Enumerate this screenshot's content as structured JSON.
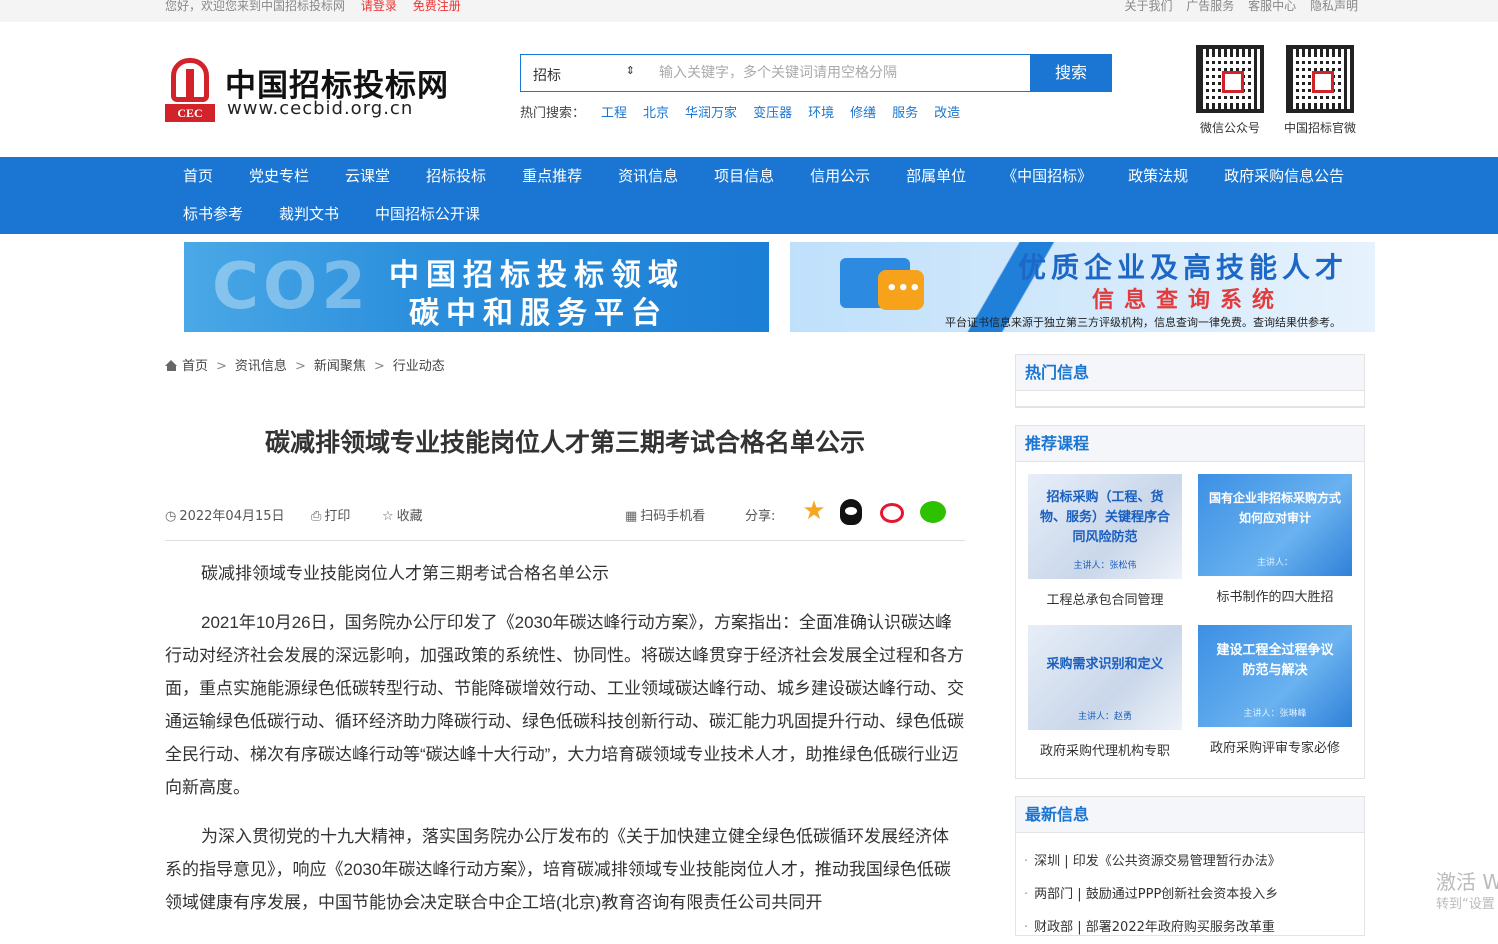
{
  "topbar": {
    "greeting": "您好，欢迎您来到中国招标投标网",
    "login": "请登录",
    "register": "免费注册",
    "links": [
      "关于我们",
      "广告服务",
      "客服中心",
      "隐私声明"
    ]
  },
  "header": {
    "logo_name": "中国招标投标网",
    "logo_url": "www.cecbid.org.cn",
    "logo_badge": "CEC",
    "search": {
      "category": "招标",
      "placeholder": "输入关键字，多个关键词请用空格分隔",
      "button": "搜索"
    },
    "hot_label": "热门搜索：",
    "hot_keywords": [
      "工程",
      "北京",
      "华润万家",
      "变压器",
      "环境",
      "修缮",
      "服务",
      "改造"
    ],
    "qr_codes": [
      {
        "label": "微信公众号"
      },
      {
        "label": "中国招标官微"
      }
    ]
  },
  "nav": {
    "row1": [
      "首页",
      "党史专栏",
      "云课堂",
      "招标投标",
      "重点推荐",
      "资讯信息",
      "项目信息",
      "信用公示",
      "部属单位",
      "《中国招标》",
      "政策法规",
      "政府采购信息公告"
    ],
    "row2": [
      "标书参考",
      "裁判文书",
      "中国招标公开课"
    ]
  },
  "banners": {
    "left": {
      "bg_text": "CO2",
      "line1": "中国招标投标领域",
      "line2": "碳中和服务平台"
    },
    "right": {
      "line1": "优质企业及高技能人才",
      "line2": "信息查询系统",
      "note": "平台证书信息来源于独立第三方评级机构，信息查询一律免费。查询结果供参考。"
    }
  },
  "breadcrumb": [
    "首页",
    "资讯信息",
    "新闻聚焦",
    "行业动态"
  ],
  "article": {
    "title": "碳减排领域专业技能岗位人才第三期考试合格名单公示",
    "date": "2022年04月15日",
    "print": "打印",
    "favorite": "收藏",
    "qr_view": "扫码手机看",
    "share_label": "分享:",
    "paragraphs": [
      "碳减排领域专业技能岗位人才第三期考试合格名单公示",
      "2021年10月26日，国务院办公厅印发了《2030年碳达峰行动方案》，方案指出：全面准确认识碳达峰行动对经济社会发展的深远影响，加强政策的系统性、协同性。将碳达峰贯穿于经济社会发展全过程和各方面，重点实施能源绿色低碳转型行动、节能降碳增效行动、工业领域碳达峰行动、城乡建设碳达峰行动、交通运输绿色低碳行动、循环经济助力降碳行动、绿色低碳科技创新行动、碳汇能力巩固提升行动、绿色低碳全民行动、梯次有序碳达峰行动等“碳达峰十大行动”，大力培育碳领域专业技术人才，助推绿色低碳行业迈向新高度。",
      "为深入贯彻党的十九大精神，落实国务院办公厅发布的《关于加快建立健全绿色低碳循环发展经济体系的指导意见》，响应《2030年碳达峰行动方案》，培育碳减排领域专业技能岗位人才，推动我国绿色低碳领域健康有序发展，中国节能协会决定联合中企工培(北京)教育咨询有限责任公司共同开"
    ]
  },
  "sidebar": {
    "hot_title": "热门信息",
    "courses_title": "推荐课程",
    "courses": [
      {
        "cover_title": "招标采购（工程、货物、服务）关键程序合同风险防范",
        "speaker": "主讲人：张松伟",
        "caption": "工程总承包合同管理"
      },
      {
        "cover_title": "国有企业非招标采购方式如何应对审计",
        "speaker": "主讲人：",
        "caption": "标书制作的四大胜招"
      },
      {
        "cover_title": "采购需求识别和定义",
        "speaker": "主讲人：赵勇",
        "caption": "政府采购代理机构专职"
      },
      {
        "cover_title": "建设工程全过程争议防范与解决",
        "speaker": "主讲人：张琳峰",
        "caption": "政府采购评审专家必修"
      }
    ],
    "news_title": "最新信息",
    "news": [
      "深圳 | 印发《公共资源交易管理暂行办法》",
      "两部门 | 鼓励通过PPP创新社会资本投入乡",
      "财政部 | 部署2022年政府购买服务改革重"
    ]
  },
  "watermark": {
    "line1": "激活 W",
    "line2": "转到“设置"
  }
}
